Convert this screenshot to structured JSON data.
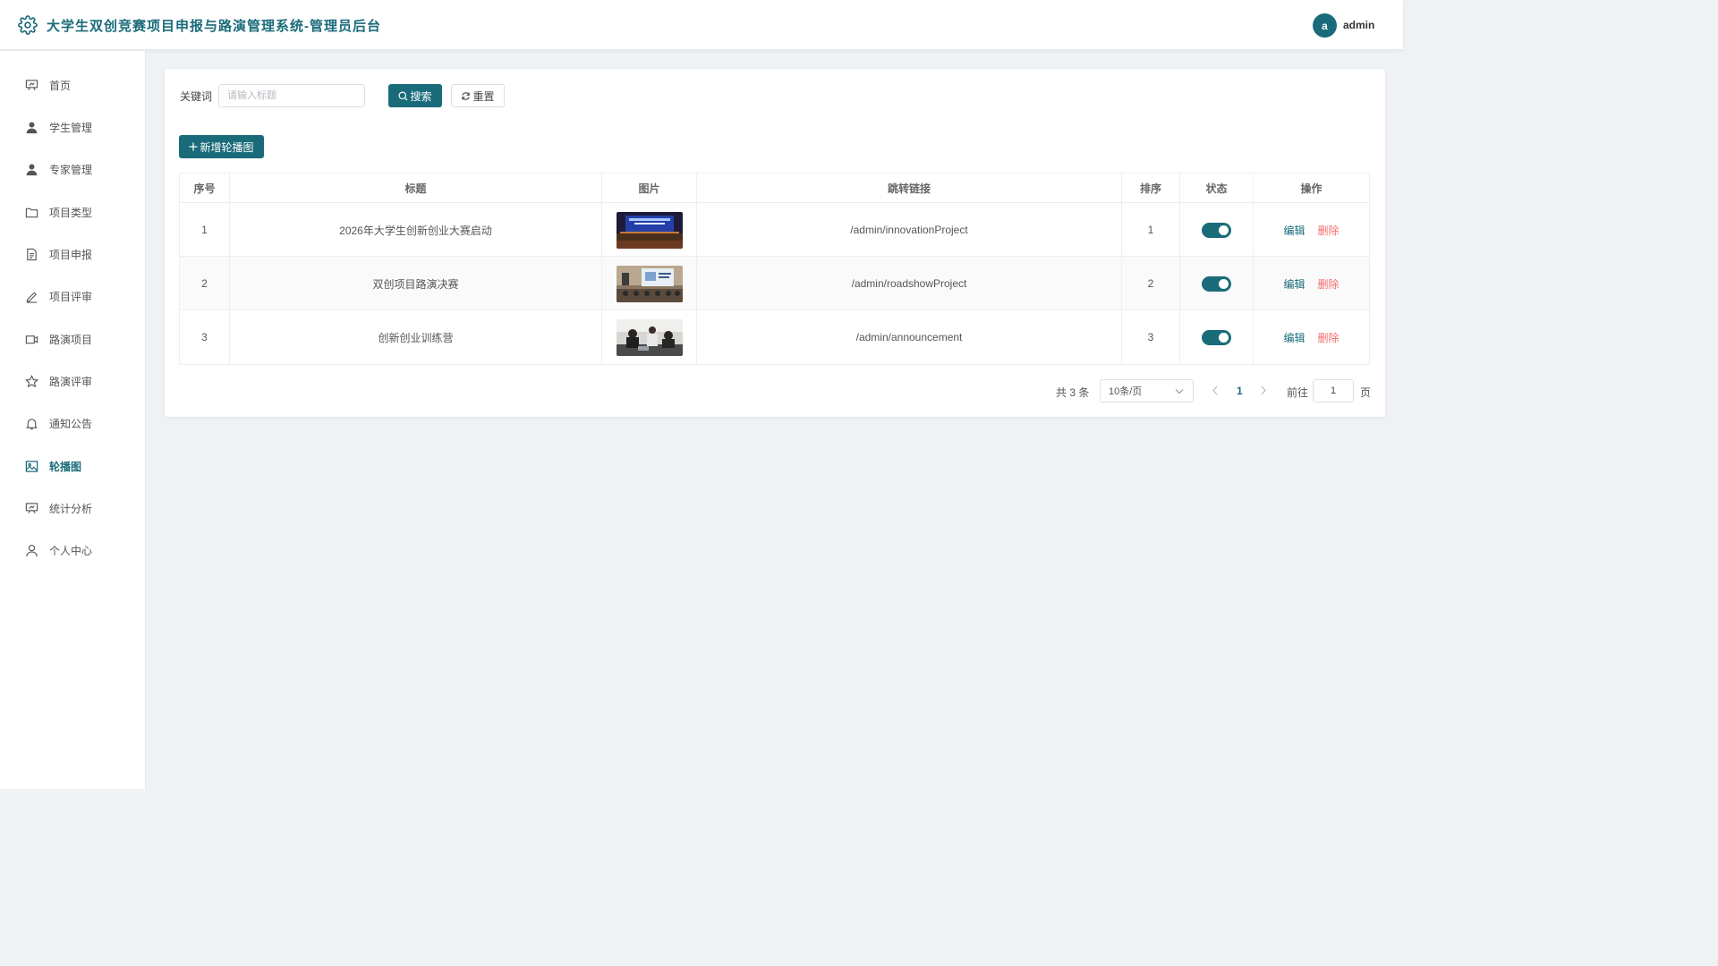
{
  "header": {
    "title": "大学生双创竞赛项目申报与路演管理系统-管理员后台",
    "avatar_letter": "a",
    "username": "admin"
  },
  "sidebar": {
    "items": [
      {
        "label": "首页",
        "icon": "presentation-board-icon",
        "active": false
      },
      {
        "label": "学生管理",
        "icon": "user-filled-icon",
        "active": false
      },
      {
        "label": "专家管理",
        "icon": "user-filled-icon",
        "active": false
      },
      {
        "label": "项目类型",
        "icon": "folder-icon",
        "active": false
      },
      {
        "label": "项目申报",
        "icon": "document-icon",
        "active": false
      },
      {
        "label": "项目评审",
        "icon": "edit-pen-icon",
        "active": false
      },
      {
        "label": "路演项目",
        "icon": "video-camera-icon",
        "active": false
      },
      {
        "label": "路演评审",
        "icon": "star-icon",
        "active": false
      },
      {
        "label": "通知公告",
        "icon": "bell-icon",
        "active": false
      },
      {
        "label": "轮播图",
        "icon": "picture-icon",
        "active": true
      },
      {
        "label": "统计分析",
        "icon": "presentation-board-icon",
        "active": false
      },
      {
        "label": "个人中心",
        "icon": "user-outline-icon",
        "active": false
      }
    ]
  },
  "search": {
    "label": "关键词",
    "placeholder": "请输入标题",
    "value": "",
    "search_button": "搜索",
    "reset_button": "重置"
  },
  "toolbar": {
    "add_button": "新增轮播图"
  },
  "table": {
    "columns": [
      "序号",
      "标题",
      "图片",
      "跳转链接",
      "排序",
      "状态",
      "操作"
    ],
    "rows": [
      {
        "index": "1",
        "title": "2026年大学生创新创业大赛启动",
        "image": "conference-stage-photo",
        "link": "/admin/innovationProject",
        "sort": "1",
        "status": true,
        "edit": "编辑",
        "delete": "删除"
      },
      {
        "index": "2",
        "title": "双创项目路演决赛",
        "image": "presentation-room-photo",
        "link": "/admin/roadshowProject",
        "sort": "2",
        "status": true,
        "edit": "编辑",
        "delete": "删除"
      },
      {
        "index": "3",
        "title": "创新创业训练营",
        "image": "workshop-team-photo",
        "link": "/admin/announcement",
        "sort": "3",
        "status": true,
        "edit": "编辑",
        "delete": "删除"
      }
    ]
  },
  "pagination": {
    "total_text": "共 3 条",
    "page_size": "10条/页",
    "current_page": "1",
    "goto_label": "前往",
    "goto_value": "1",
    "page_suffix": "页"
  },
  "colors": {
    "primary": "#1a6b7a",
    "danger": "#f56c6c",
    "background": "#eef2f5"
  }
}
